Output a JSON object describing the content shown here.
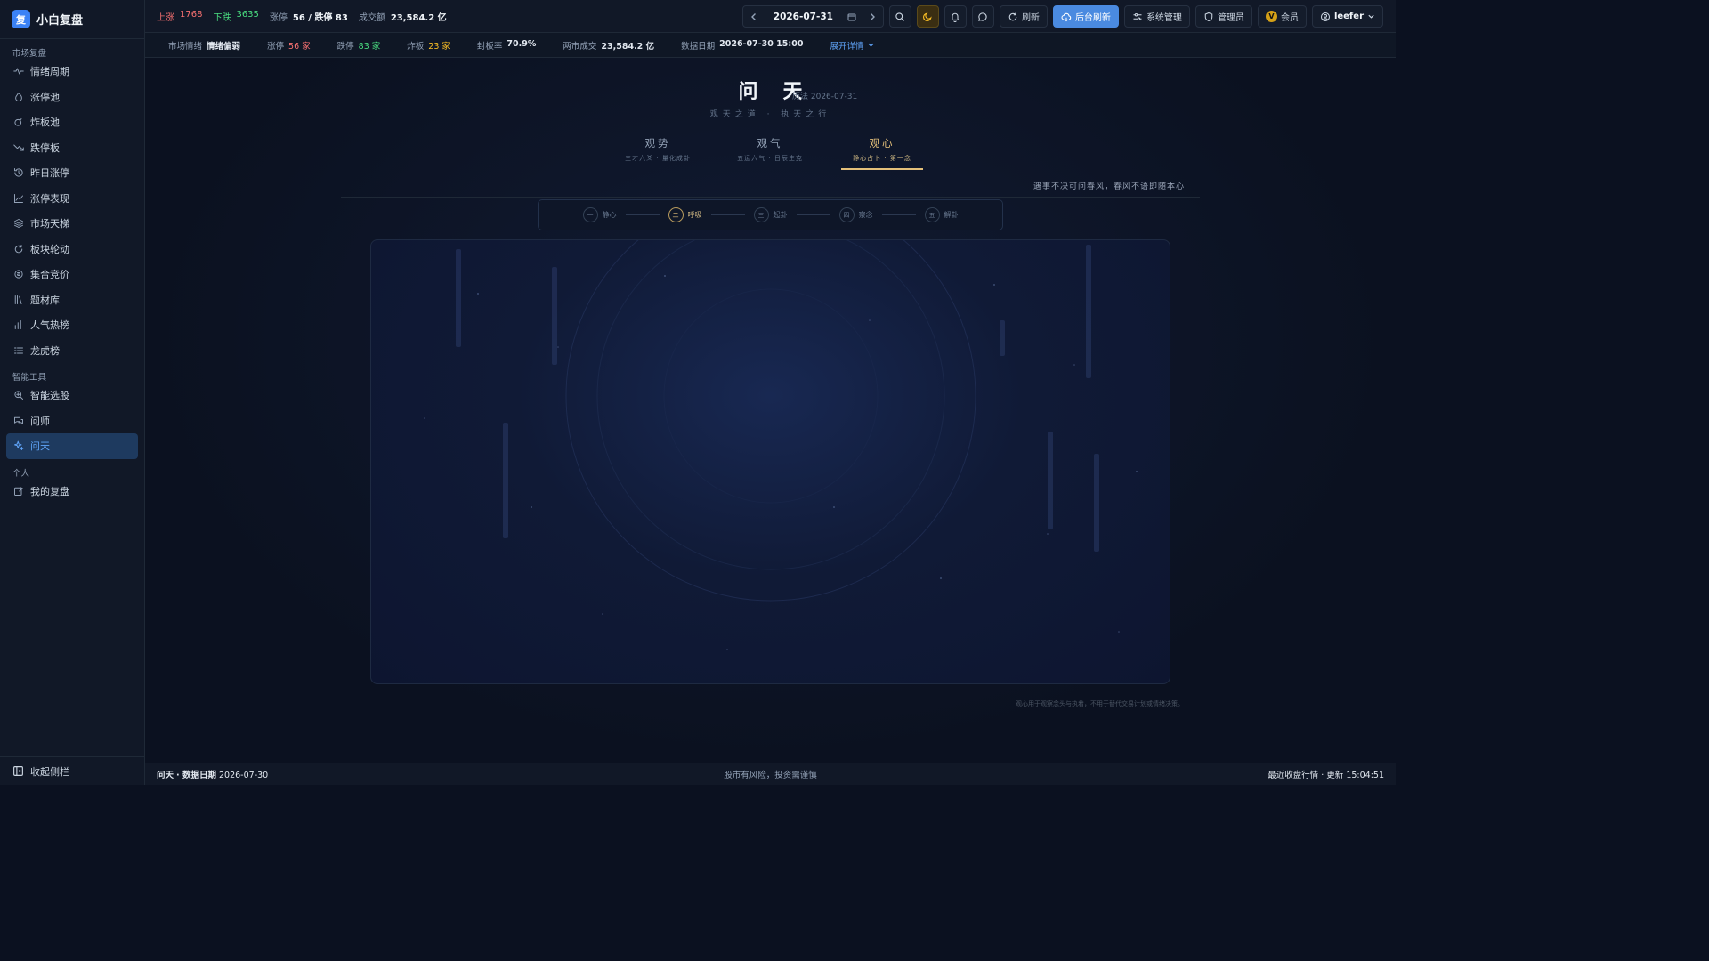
{
  "brand": {
    "logo": "复",
    "name": "小白复盘"
  },
  "sidebar": {
    "groups": [
      {
        "title": "市场复盘",
        "items": [
          {
            "label": "情绪周期",
            "icon": "pulse-icon"
          },
          {
            "label": "涨停池",
            "icon": "flame-icon"
          },
          {
            "label": "炸板池",
            "icon": "bomb-icon"
          },
          {
            "label": "跌停板",
            "icon": "trend-down-icon"
          },
          {
            "label": "昨日涨停",
            "icon": "history-icon"
          },
          {
            "label": "涨停表现",
            "icon": "chart-area-icon"
          },
          {
            "label": "市场天梯",
            "icon": "layers-icon"
          },
          {
            "label": "板块轮动",
            "icon": "refresh-icon"
          },
          {
            "label": "集合竞价",
            "icon": "coins-icon"
          },
          {
            "label": "题材库",
            "icon": "library-icon"
          },
          {
            "label": "人气热榜",
            "icon": "bar-chart-icon"
          },
          {
            "label": "龙虎榜",
            "icon": "list-icon"
          }
        ]
      },
      {
        "title": "智能工具",
        "items": [
          {
            "label": "智能选股",
            "icon": "search-plus-icon"
          },
          {
            "label": "问师",
            "icon": "chat-icon"
          },
          {
            "label": "问天",
            "icon": "sparkles-icon",
            "active": true
          }
        ]
      },
      {
        "title": "个人",
        "items": [
          {
            "label": "我的复盘",
            "icon": "edit-icon"
          }
        ]
      }
    ],
    "collapse_label": "收起侧栏"
  },
  "topbar": {
    "up_label": "上涨",
    "up_value": "1768",
    "down_label": "下跌",
    "down_value": "3635",
    "limit_label": "涨停",
    "limit_value": "56 / 跌停 83",
    "volume_label": "成交额",
    "volume_value": "23,584.2 亿",
    "date": "2026-07-31",
    "refresh_label": "刷新",
    "bg_refresh_label": "后台刷新",
    "sys_label": "系统管理",
    "admin_label": "管理员",
    "vip_badge": "V",
    "vip_label": "会员",
    "user_label": "leefer"
  },
  "subbar": {
    "mood_label": "市场情绪",
    "mood_value": "情绪偏弱",
    "up_limit_label": "涨停",
    "up_limit_value": "56 家",
    "down_limit_label": "跌停",
    "down_limit_value": "83 家",
    "broken_label": "炸板",
    "broken_value": "23 家",
    "seal_label": "封板率",
    "seal_value": "70.9%",
    "turnover_label": "两市成交",
    "turnover_value": "23,584.2 亿",
    "data_date_label": "数据日期",
    "data_date_value": "2026-07-30 15:00",
    "expand_label": "展开详情"
  },
  "page": {
    "title": "问天",
    "lunar": "历法 2026-07-31",
    "subtitle": "观天之道 · 执天之行",
    "tabs": [
      {
        "main": "观势",
        "sub": "三才六爻 · 量化成卦"
      },
      {
        "main": "观气",
        "sub": "五运六气 · 日辰生克"
      },
      {
        "main": "观心",
        "sub": "静心占卜 · 第一念",
        "active": true
      }
    ],
    "quote": "遇事不决可问春风，春风不语即随本心",
    "steps": [
      {
        "num": "一",
        "label": "静心"
      },
      {
        "num": "二",
        "label": "呼吸",
        "active": true
      },
      {
        "num": "三",
        "label": "起卦"
      },
      {
        "num": "四",
        "label": "察念"
      },
      {
        "num": "五",
        "label": "解卦"
      }
    ],
    "footnote": "观心用于观察念头与执着，不用于替代交易计划或情绪决策。"
  },
  "footer": {
    "left_title": "问天",
    "left_date_label": "· 数据日期",
    "left_date": "2026-07-30",
    "center": "股市有风险，投资需谨慎",
    "right": "最近收盘行情 · 更新 15:04:51"
  },
  "colors": {
    "accent": "#4a8ae0",
    "gold": "#e4c07a",
    "up": "#f87171",
    "down": "#4ade80"
  }
}
